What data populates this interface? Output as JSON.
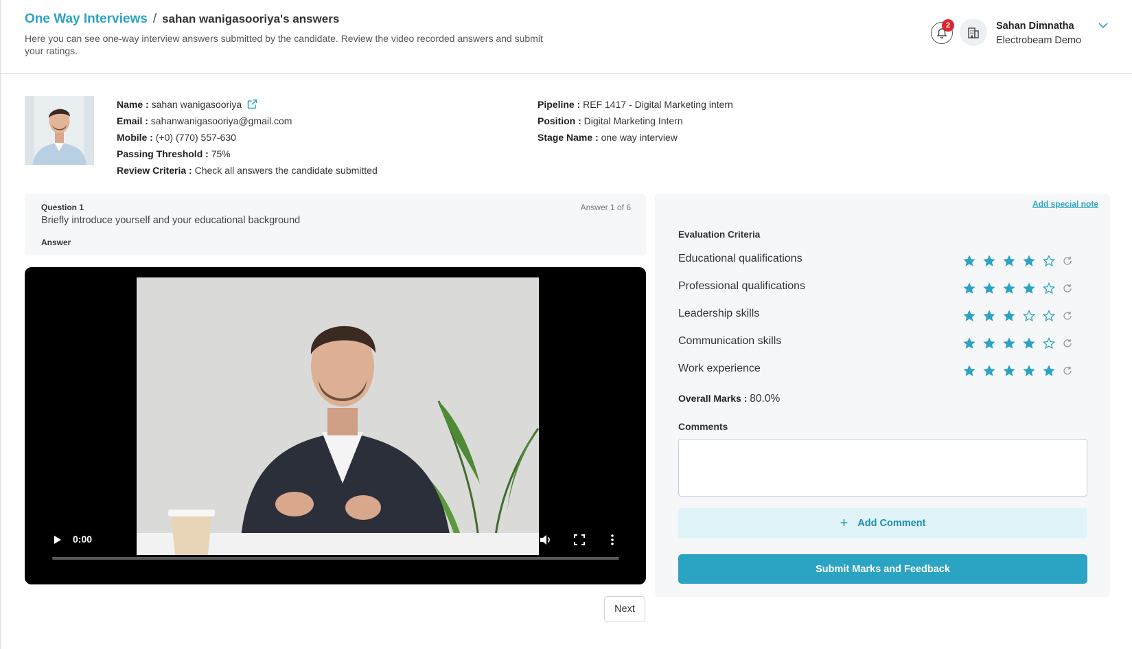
{
  "header": {
    "breadcrumb_root": "One Way Interviews",
    "breadcrumb_separator": "/",
    "breadcrumb_page": "sahan wanigasooriya's answers",
    "subtitle": "Here you can see one-way interview answers submitted by the candidate. Review the video recorded answers and submit your ratings.",
    "notifications_count": "2",
    "user_name": "Sahan Dimnatha",
    "user_org": "Electrobeam Demo"
  },
  "candidate": {
    "name_label": "Name :",
    "name": "sahan wanigasooriya",
    "email_label": "Email :",
    "email": "sahanwanigasooriya@gmail.com",
    "mobile_label": "Mobile :",
    "mobile": "(+0) (770) 557-630",
    "threshold_label": "Passing Threshold :",
    "threshold": "75%",
    "criteria_label": "Review Criteria :",
    "criteria": "Check all answers the candidate submitted",
    "pipeline_label": "Pipeline :",
    "pipeline": "REF 1417 - Digital Marketing intern",
    "position_label": "Position :",
    "position": "Digital Marketing Intern",
    "stage_label": "Stage Name :",
    "stage": "one way interview"
  },
  "question": {
    "label": "Question 1",
    "text": "Briefly introduce yourself and your educational background",
    "answer_label": "Answer",
    "counter": "Answer 1 of 6"
  },
  "video": {
    "time": "0:00",
    "progress": 0
  },
  "next_label": "Next",
  "evaluation": {
    "special_note_label": "Add special note",
    "title": "Evaluation Criteria",
    "criteria": [
      {
        "label": "Educational qualifications",
        "rating": 4,
        "max": 5
      },
      {
        "label": "Professional qualifications",
        "rating": 4,
        "max": 5
      },
      {
        "label": "Leadership skills",
        "rating": 3,
        "max": 5
      },
      {
        "label": "Communication skills",
        "rating": 4,
        "max": 5
      },
      {
        "label": "Work experience",
        "rating": 5,
        "max": 5
      }
    ],
    "overall_label": "Overall Marks :",
    "overall_value": "80.0%",
    "comments_label": "Comments",
    "comment_value": "",
    "add_comment_label": "Add Comment",
    "submit_label": "Submit Marks and Feedback"
  },
  "colors": {
    "accent": "#2ba3c2",
    "star": "#2ba3c2",
    "badge": "#d9272e"
  }
}
